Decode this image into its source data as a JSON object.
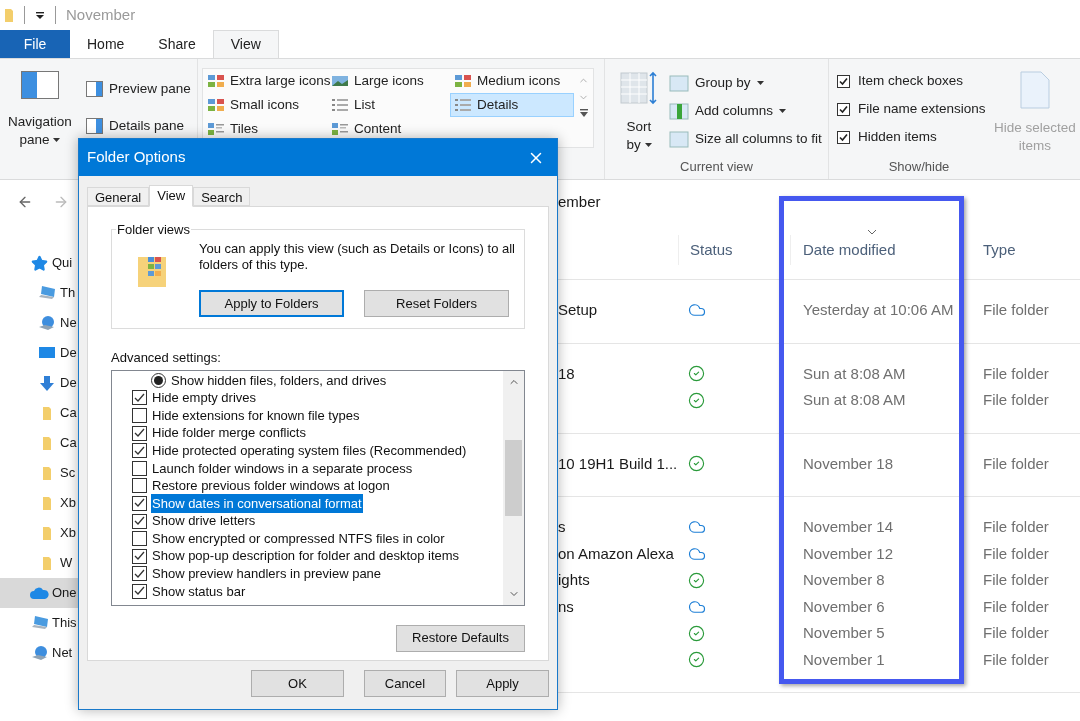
{
  "title_bar": {
    "title": "November"
  },
  "ribbon_tabs": [
    {
      "label": "File",
      "kind": "file",
      "selected": false
    },
    {
      "label": "Home",
      "kind": "tab",
      "selected": false
    },
    {
      "label": "Share",
      "kind": "tab",
      "selected": false
    },
    {
      "label": "View",
      "kind": "tab",
      "selected": true
    }
  ],
  "panes": {
    "navigation_pane": "Navigation pane",
    "preview_pane": "Preview pane",
    "details_pane": "Details pane"
  },
  "layout": [
    {
      "label": "Extra large icons",
      "selected": false
    },
    {
      "label": "Large icons",
      "selected": false
    },
    {
      "label": "Medium icons",
      "selected": false
    },
    {
      "label": "Small icons",
      "selected": false
    },
    {
      "label": "List",
      "selected": false
    },
    {
      "label": "Details",
      "selected": true
    },
    {
      "label": "Tiles",
      "selected": false
    },
    {
      "label": "Content",
      "selected": false
    }
  ],
  "current_view": {
    "label": "Current view",
    "sort_by": "Sort by",
    "items": [
      {
        "label": "Group by",
        "dropdown": true
      },
      {
        "label": "Add columns",
        "dropdown": true
      },
      {
        "label": "Size all columns to fit",
        "dropdown": false
      }
    ]
  },
  "show_hide": {
    "label": "Show/hide",
    "options": [
      {
        "label": "Item check boxes",
        "checked": true
      },
      {
        "label": "File name extensions",
        "checked": true
      },
      {
        "label": "Hidden items",
        "checked": true
      }
    ],
    "hide_selected": {
      "label": "Hide selected items",
      "disabled": true
    }
  },
  "address": {
    "path": "ember"
  },
  "sidebar": {
    "items": [
      {
        "label": "Qui",
        "kind": "quick_access",
        "selected": false,
        "children": [
          {
            "label": "Th",
            "kind": "pc",
            "selected": false
          },
          {
            "label": "Ne",
            "kind": "network",
            "selected": false
          },
          {
            "label": "De",
            "kind": "desktop",
            "selected": false
          },
          {
            "label": "De",
            "kind": "downloads",
            "selected": false
          },
          {
            "label": "Ca",
            "kind": "folder",
            "selected": false
          },
          {
            "label": "Ca",
            "kind": "folder",
            "selected": false
          },
          {
            "label": "Sc",
            "kind": "folder",
            "selected": false
          },
          {
            "label": "Xb",
            "kind": "folder",
            "selected": false
          },
          {
            "label": "Xb",
            "kind": "folder",
            "selected": false
          },
          {
            "label": "W",
            "kind": "folder",
            "selected": false
          }
        ]
      },
      {
        "label": "One",
        "kind": "cloud",
        "selected": true
      },
      {
        "label": "This",
        "kind": "pc",
        "selected": false
      },
      {
        "label": "Net",
        "kind": "network",
        "selected": false
      }
    ]
  },
  "file_list": {
    "columns": [
      {
        "label": "Status",
        "sorted": false
      },
      {
        "label": "Date modified",
        "sorted": true
      },
      {
        "label": "Type",
        "sorted": false
      }
    ],
    "groups": [
      {
        "rows": [
          {
            "name": "Setup",
            "status": {
              "kind": "cloud"
            },
            "date": "Yesterday at 10:06 AM",
            "type": "File folder"
          }
        ]
      },
      {
        "rows": [
          {
            "name": "18",
            "status": {
              "kind": "synced"
            },
            "date": "Sun at 8:08 AM",
            "type": "File folder"
          },
          {
            "status": {
              "kind": "synced"
            },
            "date": "Sun at 8:08 AM",
            "type": "File folder"
          }
        ]
      },
      {
        "rows": [
          {
            "name": "10 19H1 Build 1...",
            "status": {
              "kind": "synced"
            },
            "date": "November 18",
            "type": "File folder"
          }
        ]
      },
      {
        "rows": [
          {
            "name": "s",
            "status": {
              "kind": "cloud"
            },
            "date": "November 14",
            "type": "File folder"
          },
          {
            "name": "on Amazon Alexa",
            "status": {
              "kind": "cloud"
            },
            "date": "November 12",
            "type": "File folder"
          },
          {
            "name": "ights",
            "status": {
              "kind": "synced"
            },
            "date": "November 8",
            "type": "File folder"
          },
          {
            "name": "ns",
            "status": {
              "kind": "cloud"
            },
            "date": "November 6",
            "type": "File folder"
          },
          {
            "status": {
              "kind": "synced"
            },
            "date": "November 5",
            "type": "File folder"
          },
          {
            "status": {
              "kind": "synced"
            },
            "date": "November 1",
            "type": "File folder"
          }
        ]
      }
    ]
  },
  "dialog": {
    "title": "Folder Options",
    "tabs": [
      {
        "label": "General",
        "selected": false
      },
      {
        "label": "View",
        "selected": true
      },
      {
        "label": "Search",
        "selected": false
      }
    ],
    "folder_views": {
      "legend": "Folder views",
      "text": "You can apply this view (such as Details or Icons) to all folders of this type.",
      "buttons": [
        {
          "label": "Apply to Folders",
          "default": true
        },
        {
          "label": "Reset Folders",
          "default": false
        }
      ]
    },
    "advanced_label": "Advanced settings:",
    "settings": [
      {
        "kind": "radio",
        "label": "Show hidden files, folders, and drives",
        "checked": true,
        "selected": false
      },
      {
        "kind": "checkbox",
        "label": "Hide empty drives",
        "checked": true,
        "selected": false
      },
      {
        "kind": "checkbox",
        "label": "Hide extensions for known file types",
        "checked": false,
        "selected": false
      },
      {
        "kind": "checkbox",
        "label": "Hide folder merge conflicts",
        "checked": true,
        "selected": false
      },
      {
        "kind": "checkbox",
        "label": "Hide protected operating system files (Recommended)",
        "checked": true,
        "selected": false
      },
      {
        "kind": "checkbox",
        "label": "Launch folder windows in a separate process",
        "checked": false,
        "selected": false
      },
      {
        "kind": "checkbox",
        "label": "Restore previous folder windows at logon",
        "checked": false,
        "selected": false
      },
      {
        "kind": "checkbox",
        "label": "Show dates in conversational format",
        "checked": true,
        "selected": true
      },
      {
        "kind": "checkbox",
        "label": "Show drive letters",
        "checked": true,
        "selected": false
      },
      {
        "kind": "checkbox",
        "label": "Show encrypted or compressed NTFS files in color",
        "checked": false,
        "selected": false
      },
      {
        "kind": "checkbox",
        "label": "Show pop-up description for folder and desktop items",
        "checked": true,
        "selected": false
      },
      {
        "kind": "checkbox",
        "label": "Show preview handlers in preview pane",
        "checked": true,
        "selected": false
      },
      {
        "kind": "checkbox",
        "label": "Show status bar",
        "checked": true,
        "selected": false
      }
    ],
    "restore_button": "Restore Defaults",
    "buttons": [
      "OK",
      "Cancel",
      "Apply"
    ]
  }
}
